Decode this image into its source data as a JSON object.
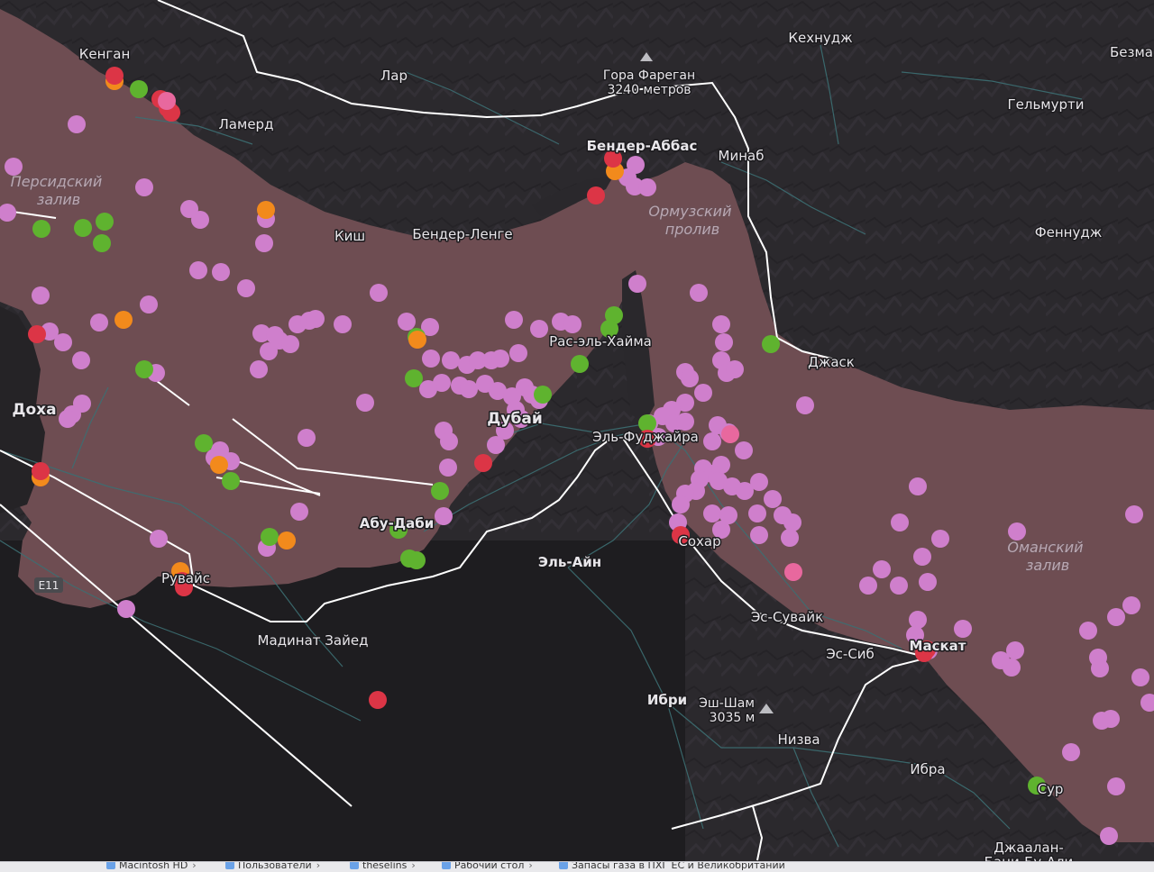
{
  "map": {
    "water_labels": [
      {
        "name": "persian-gulf-label",
        "lines": [
          "Персидский",
          "залив"
        ]
      },
      {
        "name": "strait-of-hormuz-label",
        "lines": [
          "Ормузский",
          "пролив"
        ]
      },
      {
        "name": "gulf-of-oman-label",
        "lines": [
          "Оманский",
          "залив"
        ]
      }
    ],
    "place_labels": [
      {
        "name": "city-kengan",
        "text": "Кенган"
      },
      {
        "name": "city-lar",
        "text": "Лар"
      },
      {
        "name": "peak-fareghan",
        "text": "Гора Фареган"
      },
      {
        "name": "peak-fareghan-elevation",
        "text": "3240 метров"
      },
      {
        "name": "city-kehnuj",
        "text": "Кехнудж"
      },
      {
        "name": "city-bezma",
        "text": "Безма"
      },
      {
        "name": "city-lamerd",
        "text": "Ламерд"
      },
      {
        "name": "city-bandar-abbas",
        "text": "Бендер-Аббас"
      },
      {
        "name": "city-minab",
        "text": "Минаб"
      },
      {
        "name": "city-gelmurti",
        "text": "Гельмурти"
      },
      {
        "name": "city-kish",
        "text": "Киш"
      },
      {
        "name": "city-bandar-lengeh",
        "text": "Бендер-Ленге"
      },
      {
        "name": "city-fennuj",
        "text": "Феннудж"
      },
      {
        "name": "city-ras-al-khaimah",
        "text": "Рас-эль-Хайма"
      },
      {
        "name": "city-jask",
        "text": "Джаск"
      },
      {
        "name": "city-doha",
        "text": "Доха"
      },
      {
        "name": "city-dubai",
        "text": "Дубай"
      },
      {
        "name": "city-fujairah",
        "text": "Эль-Фуджайра"
      },
      {
        "name": "city-abu-dhabi",
        "text": "Абу-Даби"
      },
      {
        "name": "city-sohar",
        "text": "Сохар"
      },
      {
        "name": "city-ruwais",
        "text": "Рувайс"
      },
      {
        "name": "city-al-ain",
        "text": "Эль-Айн"
      },
      {
        "name": "road-e11",
        "text": "E11"
      },
      {
        "name": "city-suwaik",
        "text": "Эс-Сувайк"
      },
      {
        "name": "city-madinat-zayed",
        "text": "Мадинат Зайед"
      },
      {
        "name": "city-seeb",
        "text": "Эс-Сиб"
      },
      {
        "name": "city-muscat",
        "text": "Маскат"
      },
      {
        "name": "city-ibri",
        "text": "Ибри"
      },
      {
        "name": "peak-jebel-shams",
        "text": "Эш-Шам"
      },
      {
        "name": "peak-jebel-shams-elevation",
        "text": "3035 м"
      },
      {
        "name": "city-nizwa",
        "text": "Низва"
      },
      {
        "name": "city-ibra",
        "text": "Ибра"
      },
      {
        "name": "city-sur",
        "text": "Сур"
      },
      {
        "name": "city-jaalan",
        "text": "Джаалан-"
      },
      {
        "name": "city-jaalan-2",
        "text": "Бани-Бу-Али"
      }
    ],
    "marker_colors": {
      "pink": "#cf7fcc",
      "green": "#5fb32f",
      "orange": "#f28a1c",
      "red": "#dc3546",
      "hotpink": "#e8689e"
    },
    "land_color": "#6e4d52",
    "terrain_color": "#2a282c"
  },
  "statusbar": {
    "crumbs": [
      "Macintosh HD",
      "Пользователи",
      "theselins",
      "Рабочий стол",
      "Запасы газа в ПХГ ЕС и Великобритании"
    ]
  }
}
